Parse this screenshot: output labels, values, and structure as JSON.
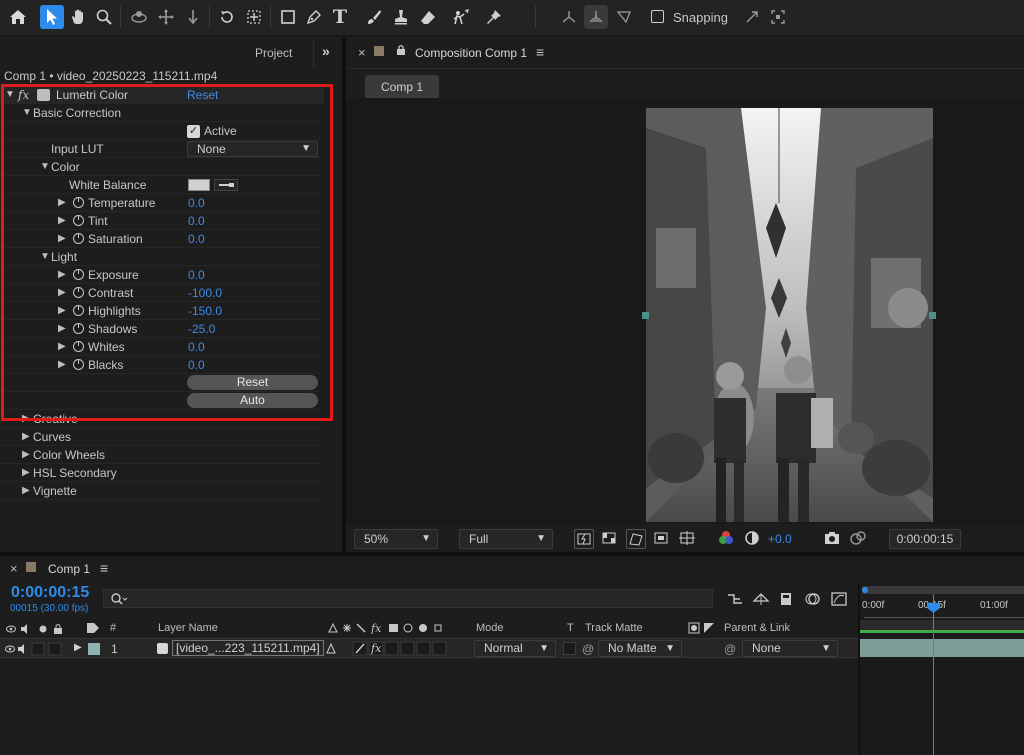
{
  "toolbar": {
    "snapping_label": "Snapping",
    "tools": [
      "home-icon",
      "selection-icon",
      "hand-icon",
      "zoom-icon",
      "orbit-icon",
      "pan-icon",
      "dolly-icon",
      "rotate-icon",
      "pan-behind-icon",
      "rectangle-icon",
      "pen-icon",
      "type-icon",
      "brush-icon",
      "clone-stamp-icon",
      "eraser-icon",
      "roto-brush-icon",
      "puppet-pin-icon"
    ]
  },
  "left_panel": {
    "tab_project": "Project",
    "breadcrumb": "Comp 1 • video_20250223_115211.mp4",
    "effect": {
      "fx": "fx",
      "name": "Lumetri Color",
      "reset": "Reset",
      "basic_correction": "Basic Correction",
      "active_label": "Active",
      "input_lut_label": "Input LUT",
      "input_lut_value": "None",
      "color_label": "Color",
      "white_balance_label": "White Balance",
      "color_params": [
        {
          "label": "Temperature",
          "value": "0.0"
        },
        {
          "label": "Tint",
          "value": "0.0"
        },
        {
          "label": "Saturation",
          "value": "0.0"
        }
      ],
      "light_label": "Light",
      "light_params": [
        {
          "label": "Exposure",
          "value": "0.0"
        },
        {
          "label": "Contrast",
          "value": "-100.0"
        },
        {
          "label": "Highlights",
          "value": "-150.0"
        },
        {
          "label": "Shadows",
          "value": "-25.0"
        },
        {
          "label": "Whites",
          "value": "0.0"
        },
        {
          "label": "Blacks",
          "value": "0.0"
        }
      ],
      "reset_button": "Reset",
      "auto_button": "Auto",
      "sections": [
        "Creative",
        "Curves",
        "Color Wheels",
        "HSL Secondary",
        "Vignette"
      ]
    },
    "highlight_color": "#e01b1b"
  },
  "comp_panel": {
    "tab_title": "Composition Comp 1",
    "comp_button": "Comp 1",
    "zoom": "50%",
    "resolution": "Full",
    "exposure": "+0.0",
    "timecode": "0:00:00:15"
  },
  "timeline": {
    "tab_title": "Comp 1",
    "timecode": "0:00:00:15",
    "frames": "00015 (30.00 fps)",
    "search_placeholder": "",
    "ruler": [
      "0:00f",
      "00:15f",
      "01:00f"
    ],
    "columns": {
      "num": "#",
      "layer_name": "Layer Name",
      "mode": "Mode",
      "t": "T",
      "track_matte": "Track Matte",
      "parent": "Parent & Link"
    },
    "layer": {
      "number": "1",
      "name": "[video_...223_115211.mp4]",
      "mode": "Normal",
      "track_matte": "No Matte",
      "parent": "None",
      "fx": "fx"
    },
    "accent": "#2d8ceb"
  }
}
